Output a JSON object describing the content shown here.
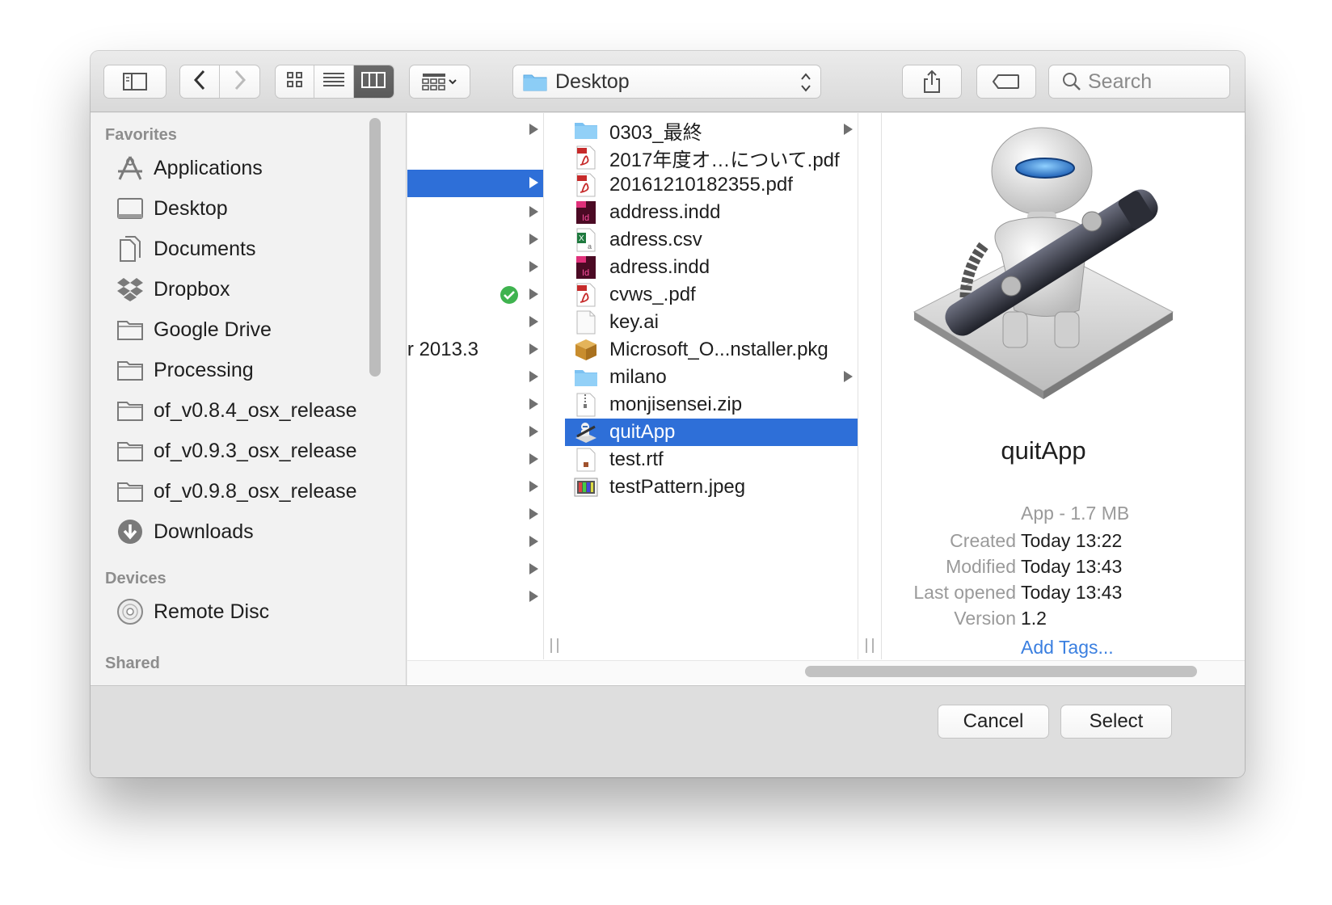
{
  "toolbar": {
    "location": "Desktop",
    "search_placeholder": "Search"
  },
  "sidebar": {
    "favorites_heading": "Favorites",
    "favorites": [
      {
        "label": "Applications",
        "icon": "applications-icon"
      },
      {
        "label": "Desktop",
        "icon": "desktop-icon"
      },
      {
        "label": "Documents",
        "icon": "documents-icon"
      },
      {
        "label": "Dropbox",
        "icon": "dropbox-icon"
      },
      {
        "label": "Google Drive",
        "icon": "folder-icon"
      },
      {
        "label": "Processing",
        "icon": "folder-icon"
      },
      {
        "label": "of_v0.8.4_osx_release",
        "icon": "folder-icon"
      },
      {
        "label": "of_v0.9.3_osx_release",
        "icon": "folder-icon"
      },
      {
        "label": "of_v0.9.8_osx_release",
        "icon": "folder-icon"
      },
      {
        "label": "Downloads",
        "icon": "downloads-icon"
      }
    ],
    "devices_heading": "Devices",
    "devices": [
      {
        "label": "Remote Disc",
        "icon": "disc-icon"
      }
    ],
    "shared_heading": "Shared"
  },
  "column1": {
    "visible_text": "r 2013.3"
  },
  "column2": {
    "items": [
      {
        "name": "0303_最終",
        "type": "folder",
        "has_children": true
      },
      {
        "name": "2017年度オ…について.pdf",
        "type": "pdf"
      },
      {
        "name": "20161210182355.pdf",
        "type": "pdf"
      },
      {
        "name": "address.indd",
        "type": "indd"
      },
      {
        "name": "adress.csv",
        "type": "csv"
      },
      {
        "name": "adress.indd",
        "type": "indd"
      },
      {
        "name": "cvws_.pdf",
        "type": "pdf"
      },
      {
        "name": "key.ai",
        "type": "doc"
      },
      {
        "name": "Microsoft_O...nstaller.pkg",
        "type": "pkg"
      },
      {
        "name": "milano",
        "type": "folder",
        "has_children": true
      },
      {
        "name": "monjisensei.zip",
        "type": "zip"
      },
      {
        "name": "quitApp",
        "type": "app",
        "selected": true
      },
      {
        "name": "test.rtf",
        "type": "rtf"
      },
      {
        "name": "testPattern.jpeg",
        "type": "image"
      }
    ]
  },
  "preview": {
    "name": "quitApp",
    "kind": "App - 1.7 MB",
    "created_label": "Created",
    "created": "Today 13:22",
    "modified_label": "Modified",
    "modified": "Today 13:43",
    "last_opened_label": "Last opened",
    "last_opened": "Today 13:43",
    "version_label": "Version",
    "version": "1.2",
    "add_tags": "Add Tags..."
  },
  "buttons": {
    "cancel": "Cancel",
    "select": "Select"
  },
  "colors": {
    "selection": "#2e6fd8",
    "link": "#3a7fe0",
    "check_green": "#3fb34f"
  }
}
